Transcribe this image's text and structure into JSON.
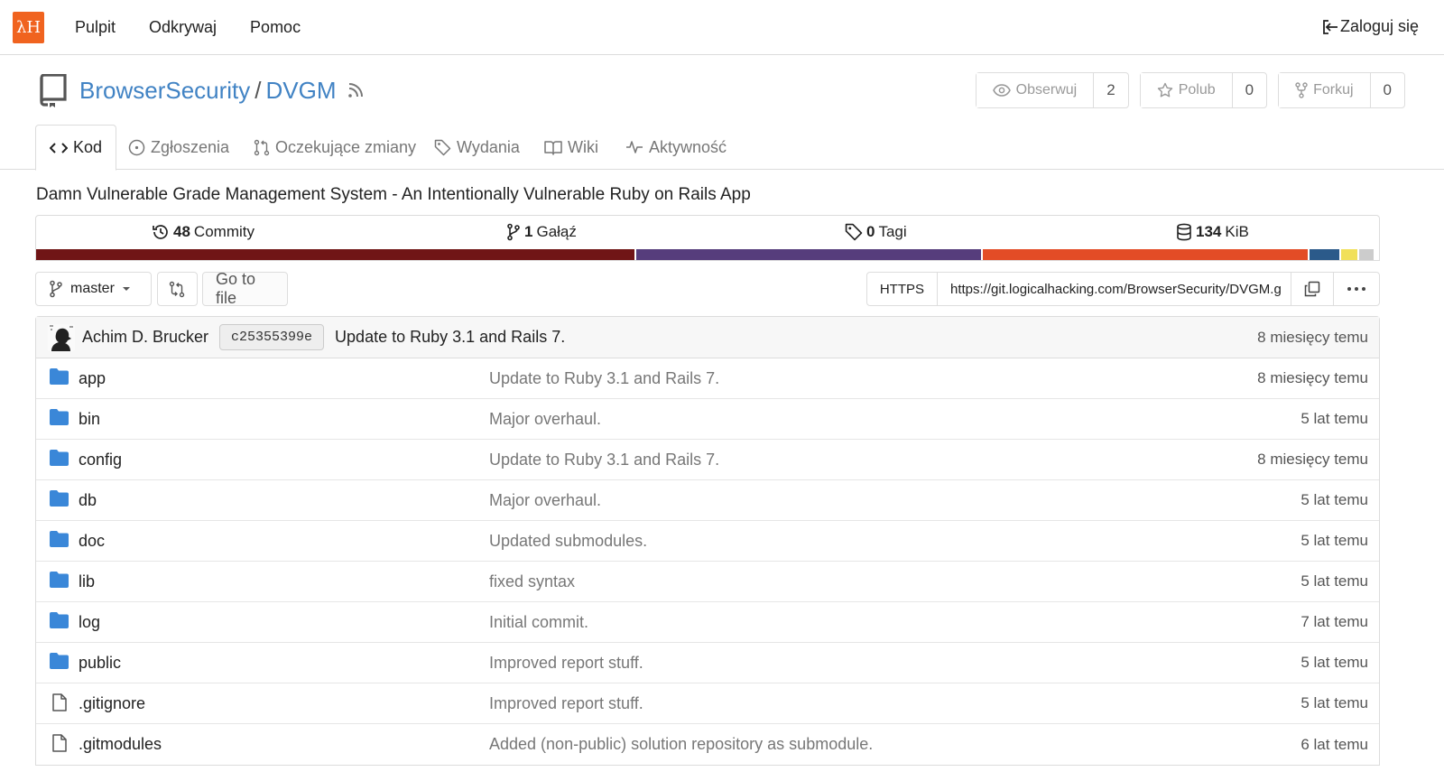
{
  "nav": {
    "logo_text": "λH",
    "links": [
      "Pulpit",
      "Odkrywaj",
      "Pomoc"
    ],
    "login": "Zaloguj się"
  },
  "repo": {
    "owner": "BrowserSecurity",
    "separator": "/",
    "name": "DVGM",
    "watch": {
      "label": "Obserwuj",
      "count": "2"
    },
    "star": {
      "label": "Polub",
      "count": "0"
    },
    "fork": {
      "label": "Forkuj",
      "count": "0"
    },
    "description": "Damn Vulnerable Grade Management System - An Intentionally Vulnerable Ruby on Rails App"
  },
  "tabs": [
    {
      "label": "Kod",
      "icon": "code-icon"
    },
    {
      "label": "Zgłoszenia",
      "icon": "issue-icon"
    },
    {
      "label": "Oczekujące zmiany",
      "icon": "pull-request-icon"
    },
    {
      "label": "Wydania",
      "icon": "tag-icon"
    },
    {
      "label": "Wiki",
      "icon": "book-icon"
    },
    {
      "label": "Aktywność",
      "icon": "pulse-icon"
    }
  ],
  "stats": {
    "commits": {
      "count": "48",
      "label": "Commity"
    },
    "branches": {
      "count": "1",
      "label": "Gałąź"
    },
    "tags": {
      "count": "0",
      "label": "Tagi"
    },
    "size": {
      "count": "134",
      "label": "KiB"
    }
  },
  "language_colors": [
    "#701516",
    "#563d7c",
    "#e34c26",
    "#2b5a8a",
    "#f1e05a",
    "#cccccc"
  ],
  "language_shares": [
    0.447,
    0.258,
    0.243,
    0.024,
    0.013,
    0.011
  ],
  "branch": {
    "name": "master",
    "go_to_file": "Go to file",
    "clone_protocol": "HTTPS",
    "clone_url": "https://git.logicalhacking.com/BrowserSecurity/DVGM.g"
  },
  "last_commit": {
    "author": "Achim D. Brucker",
    "sha": "c25355399e",
    "message": "Update to Ruby 3.1 and Rails 7.",
    "time": "8 miesięcy temu"
  },
  "files": [
    {
      "name": "app",
      "type": "folder",
      "message": "Update to Ruby 3.1 and Rails 7.",
      "time": "8 miesięcy temu"
    },
    {
      "name": "bin",
      "type": "folder",
      "message": "Major overhaul.",
      "time": "5 lat temu"
    },
    {
      "name": "config",
      "type": "folder",
      "message": "Update to Ruby 3.1 and Rails 7.",
      "time": "8 miesięcy temu"
    },
    {
      "name": "db",
      "type": "folder",
      "message": "Major overhaul.",
      "time": "5 lat temu"
    },
    {
      "name": "doc",
      "type": "folder",
      "message": "Updated submodules.",
      "time": "5 lat temu"
    },
    {
      "name": "lib",
      "type": "folder",
      "message": "fixed syntax",
      "time": "5 lat temu"
    },
    {
      "name": "log",
      "type": "folder",
      "message": "Initial commit.",
      "time": "7 lat temu"
    },
    {
      "name": "public",
      "type": "folder",
      "message": "Improved report stuff.",
      "time": "5 lat temu"
    },
    {
      "name": ".gitignore",
      "type": "file",
      "message": "Improved report stuff.",
      "time": "5 lat temu"
    },
    {
      "name": ".gitmodules",
      "type": "file",
      "message": "Added (non-public) solution repository as submodule.",
      "time": "6 lat temu"
    }
  ]
}
